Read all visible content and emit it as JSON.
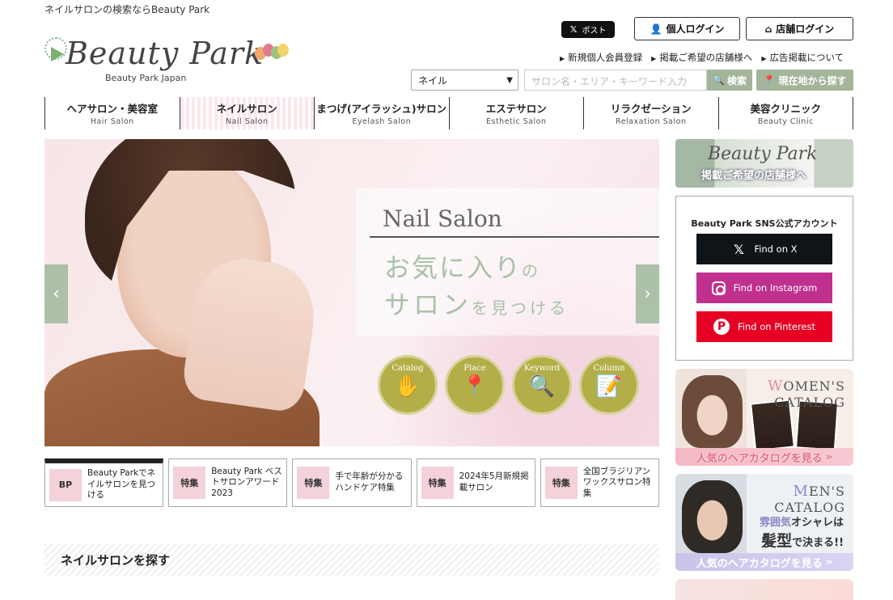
{
  "header": {
    "tagline": "ネイルサロンの検索ならBeauty Park",
    "logo_text": "Beauty Park",
    "logo_sub": "Beauty Park Japan",
    "x_post_label": "ポスト",
    "login_user": "個人ログイン",
    "login_shop": "店舗ログイン",
    "links": [
      "新規個人会員登録",
      "掲載ご希望の店舗様へ",
      "広告掲載について"
    ],
    "category_select": "ネイル",
    "search_placeholder": "サロン名・エリア・キーワード入力",
    "search_button": "検索",
    "location_button": "現在地から探す"
  },
  "nav": [
    {
      "jp": "ヘアサロン・美容室",
      "en": "Hair Salon",
      "active": false
    },
    {
      "jp": "ネイルサロン",
      "en": "Nail Salon",
      "active": true
    },
    {
      "jp": "まつげ(アイラッシュ)サロン",
      "en": "Eyelash Salon",
      "active": false
    },
    {
      "jp": "エステサロン",
      "en": "Esthetic Salon",
      "active": false
    },
    {
      "jp": "リラクゼーション",
      "en": "Relaxation Salon",
      "active": false
    },
    {
      "jp": "美容クリニック",
      "en": "Beauty Clinic",
      "active": false
    }
  ],
  "hero": {
    "title": "Nail Salon",
    "copy_line1_main": "お気に入り",
    "copy_line1_small": "の",
    "copy_line2_main": "サロン",
    "copy_line2_small": "を見つける",
    "circles": [
      {
        "label": "Catalog",
        "icon": "nail-icon"
      },
      {
        "label": "Place",
        "icon": "map-pin-icon"
      },
      {
        "label": "Keyword",
        "icon": "magnifier-icon"
      },
      {
        "label": "Column",
        "icon": "pencil-note-icon"
      }
    ]
  },
  "pickups": [
    {
      "badge": "BP",
      "text": "Beauty Parkでネイルサロンを見つける"
    },
    {
      "badge": "特集",
      "text": "Beauty Park ベストサロンアワード2023"
    },
    {
      "badge": "特集",
      "text": "手で年齢が分かるハンドケア特集"
    },
    {
      "badge": "特集",
      "text": "2024年5月新規掲載サロン"
    },
    {
      "badge": "特集",
      "text": "全国ブラジリアンワックスサロン特集"
    }
  ],
  "section_title": "ネイルサロンを探す",
  "sidebar": {
    "banner_logo": "Beauty Park",
    "banner_sub": "掲載ご希望の店舗様へ",
    "sns_title": "Beauty Park SNS公式アカウント",
    "sns": [
      {
        "label": "Find on X",
        "color": "#0f1419"
      },
      {
        "label": "Find on Instagram",
        "color": "#c0308f"
      },
      {
        "label": "Find on Pinterest",
        "color": "#e60023"
      }
    ],
    "women": {
      "first": "W",
      "line1": "OMEN'S",
      "line2": "CATALOG",
      "foot": "人気のヘアカタログを見る"
    },
    "men": {
      "first": "M",
      "line1": "EN'S",
      "line2": "CATALOG",
      "copy_a": "雰囲気",
      "copy_b": "オシャレは",
      "copy_c": "髪型",
      "copy_d": "で決まる!!",
      "foot": "人気のヘアカタログを見る"
    }
  }
}
